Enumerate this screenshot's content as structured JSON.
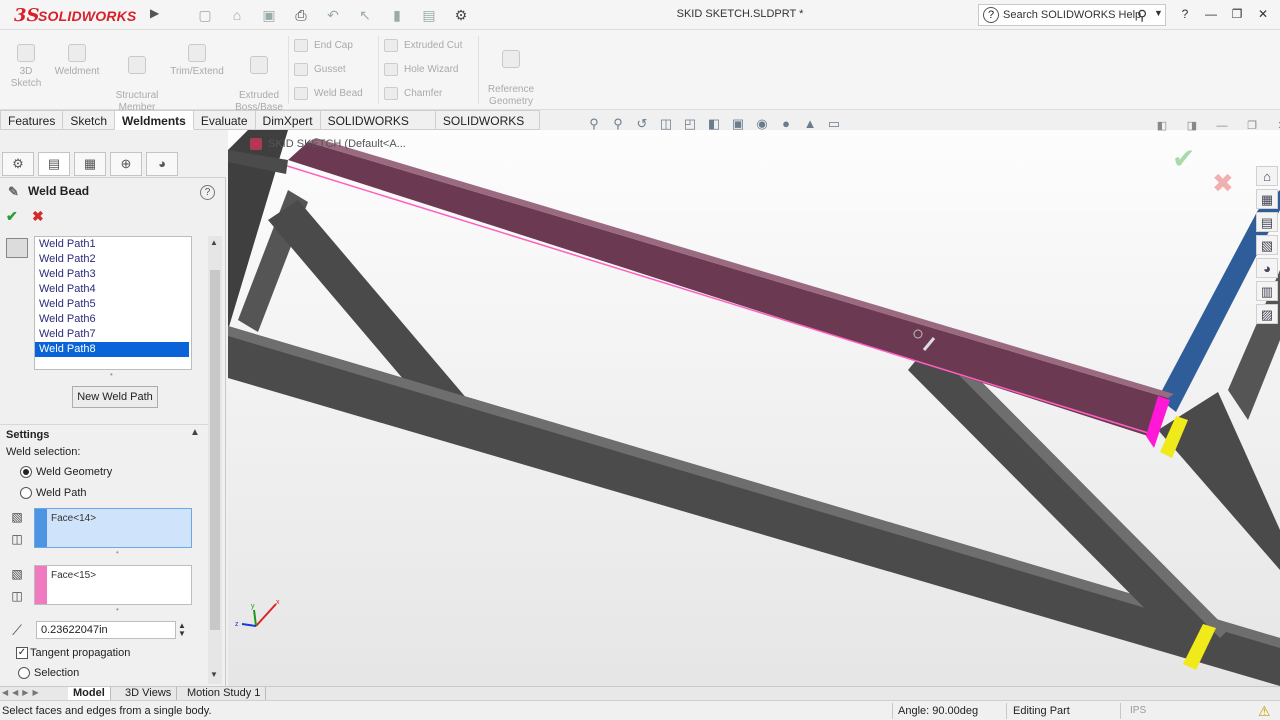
{
  "app": {
    "logo_ds": "3S",
    "logo_word": "SOLIDWORKS",
    "doc_title": "SKID SKETCH.SLDPRT *",
    "help_search": "Search SOLIDWORKS Help"
  },
  "ribbon": {
    "big_buttons": [
      {
        "label": "3D\nSketch"
      },
      {
        "label": "Weldment"
      },
      {
        "label": "Structural\nMember"
      },
      {
        "label": "Trim/Extend"
      },
      {
        "label": "Extruded\nBoss/Base"
      }
    ],
    "col1": [
      "End Cap",
      "Gusset",
      "Weld Bead"
    ],
    "col2": [
      "Extruded Cut",
      "Hole Wizard",
      "Chamfer"
    ],
    "reference": "Reference\nGeometry"
  },
  "tabs": [
    "Features",
    "Sketch",
    "Weldments",
    "Evaluate",
    "DimXpert",
    "SOLIDWORKS Add-Ins",
    "SOLIDWORKS MBD"
  ],
  "active_tab": "Weldments",
  "tree_label": "SKID SKETCH  (Default<A...",
  "pm": {
    "title": "Weld Bead",
    "weld_paths": [
      "Weld Path1",
      "Weld Path2",
      "Weld Path3",
      "Weld Path4",
      "Weld Path5",
      "Weld Path6",
      "Weld Path7",
      "Weld Path8"
    ],
    "selected_path": "Weld Path8",
    "new_path_button": "New Weld Path",
    "settings_header": "Settings",
    "weld_selection_label": "Weld selection:",
    "opt_geometry": "Weld Geometry",
    "opt_path": "Weld Path",
    "face1": "Face<14>",
    "face2": "Face<15>",
    "bead_size": "0.23622047in",
    "tangent_label": "Tangent propagation",
    "selection_label": "Selection"
  },
  "bottom_tabs": [
    "Model",
    "3D Views",
    "Motion Study 1"
  ],
  "status": {
    "message": "Select faces and edges from a single body.",
    "angle": "Angle: 90.00deg",
    "mode": "Editing Part",
    "units": "IPS"
  },
  "colors": {
    "accent_red": "#d8202a",
    "selected_beam": "#6b3a52",
    "selected_face_blue": "#2e5d9a",
    "beam_gray": "#4a4a4a",
    "weld_yellow": "#f0ea1a",
    "weld_magenta": "#ff19d6",
    "list_select": "#0a64d8"
  },
  "icons": {
    "help": "question-circle-icon",
    "search": "magnifier-icon",
    "ok": "check-icon",
    "cancel": "close-icon"
  }
}
